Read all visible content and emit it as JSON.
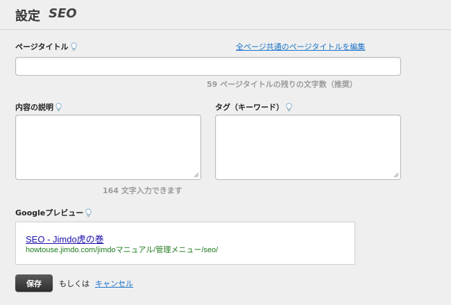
{
  "header": {
    "title_ja": "設定",
    "title_en": "SEO"
  },
  "page_title_section": {
    "label": "ページタイトル",
    "edit_link": "全ページ共通のページタイトルを編集",
    "value": "",
    "hint": "59 ページタイトルの残りの文字数（推奨）"
  },
  "description_section": {
    "label": "内容の説明",
    "value": "",
    "hint": "164 文字入力できます"
  },
  "keywords_section": {
    "label": "タグ（キーワード）",
    "value": ""
  },
  "google_preview": {
    "label": "Googleプレビュー",
    "title": "SEO - Jimdo虎の巻",
    "url": "howtouse.jimdo.com/jimdoマニュアル/管理メニュー/seo/"
  },
  "actions": {
    "save_label": "保存",
    "or_text": "もしくは",
    "cancel_label": "キャンセル"
  },
  "colors": {
    "link": "#1a73c9",
    "preview_title": "#1a0dab",
    "preview_url": "#1e7a1e",
    "save_button": "#3a3a3a"
  },
  "icons": [
    "lightbulb-icon",
    "resize-grip-icon"
  ]
}
